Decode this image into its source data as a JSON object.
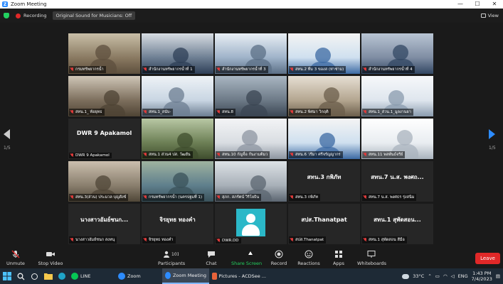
{
  "window": {
    "title": "Zoom Meeting",
    "controls": [
      "—",
      "☐",
      "✕"
    ]
  },
  "recording": {
    "label": "Recording",
    "original_sound": "Original Sound for Musicians: Off",
    "view_label": "View"
  },
  "navigation": {
    "left_page": "1/5",
    "right_page": "1/5"
  },
  "tiles": [
    {
      "name": "กรมทรัพยากรน้ำ",
      "type": "video",
      "active": true
    },
    {
      "name": "สำนักงานทรัพยากรน้ำที่ 1",
      "type": "video"
    },
    {
      "name": "สำนักงานทรัพยากรน้ำที่ 3",
      "type": "video"
    },
    {
      "name": "สทน.2 ทีม 3 ของส (ท่าช่าม)",
      "type": "video"
    },
    {
      "name": "สำนักงานทรัพยากรน้ำที่ 4",
      "type": "video"
    },
    {
      "name": "สทน.1_ ท้อยุทธ",
      "type": "video"
    },
    {
      "name": "สทน.1_สนับ-",
      "type": "video"
    },
    {
      "name": "สทน.8",
      "type": "video"
    },
    {
      "name": "สทน.2 พิศมา วิกฤติ",
      "type": "video"
    },
    {
      "name": "สทน.1_ส่วน.1_มูลงานยา",
      "type": "video"
    },
    {
      "name": "DWR 9 Apakamol",
      "type": "name"
    },
    {
      "name": "สทน.1 ส่วน4 ปส. วัฒยัน",
      "type": "video"
    },
    {
      "name": "สทน.10 กัญจื่อ กันงามติมว",
      "type": "video"
    },
    {
      "name": "สทน.6 วรีมา ศรีจรัญญากร",
      "type": "video"
    },
    {
      "name": "สทน.11 พลพันธ์จรีย์",
      "type": "video"
    },
    {
      "name": "สทน.3(ส่วน) ประมวล บุญสังข์",
      "type": "video"
    },
    {
      "name": "กรมทรัพยากรน้ำ (นครปฐมที่ 1)",
      "type": "video"
    },
    {
      "name": "สุภก. สภรัตน์ วิริโยธิน",
      "type": "video"
    },
    {
      "name": "สทน.3 กพิภัท",
      "type": "name",
      "big": "สทน.3 กพิภัท"
    },
    {
      "name": "สทน.7 น.ส. พงศธร รุ่งสนิม",
      "type": "name",
      "big": "สทน.7 น.ส. พงศถ..."
    },
    {
      "name": "นางสาวอัมย์ชนก สงหนุ",
      "type": "name",
      "big": "นางสาวอัมย์ชนก..."
    },
    {
      "name": "จิรยุทธ ทองคำ",
      "type": "name",
      "big": "จิรยุทธ ทองคำ"
    },
    {
      "name": "DWR.DD",
      "type": "avatar"
    },
    {
      "name": "สปส.Thanatpat",
      "type": "name",
      "big": "สปส.Thanatpat"
    },
    {
      "name": "สทน.1 สุพัดสอน สีมือ",
      "type": "name",
      "big": "สทน.1 สุพัดสอน..."
    }
  ],
  "toolbar": {
    "unmute": "Unmute",
    "stop_video": "Stop Video",
    "participants": "Participants",
    "participants_count": "101",
    "chat": "Chat",
    "share_screen": "Share Screen",
    "record": "Record",
    "reactions": "Reactions",
    "apps": "Apps",
    "whiteboards": "Whiteboards",
    "leave": "Leave"
  },
  "taskbar": {
    "apps": [
      {
        "label": "LINE",
        "color": "#06c755",
        "shape": "round"
      },
      {
        "label": "Zoom",
        "color": "#2d8cff",
        "shape": "round"
      },
      {
        "label": "Zoom Meeting",
        "color": "#2d8cff",
        "shape": "round",
        "active": true
      },
      {
        "label": "Pictures - ACDSee ...",
        "color": "#e8633a",
        "shape": "square"
      }
    ],
    "temperature": "33°C",
    "language": "ENG",
    "time": "1:43 PM",
    "date": "7/4/2023"
  },
  "colors": {
    "accent": "#2d8cff",
    "share": "#23d160",
    "leave": "#e02828",
    "active_speaker": "#c9e646"
  }
}
